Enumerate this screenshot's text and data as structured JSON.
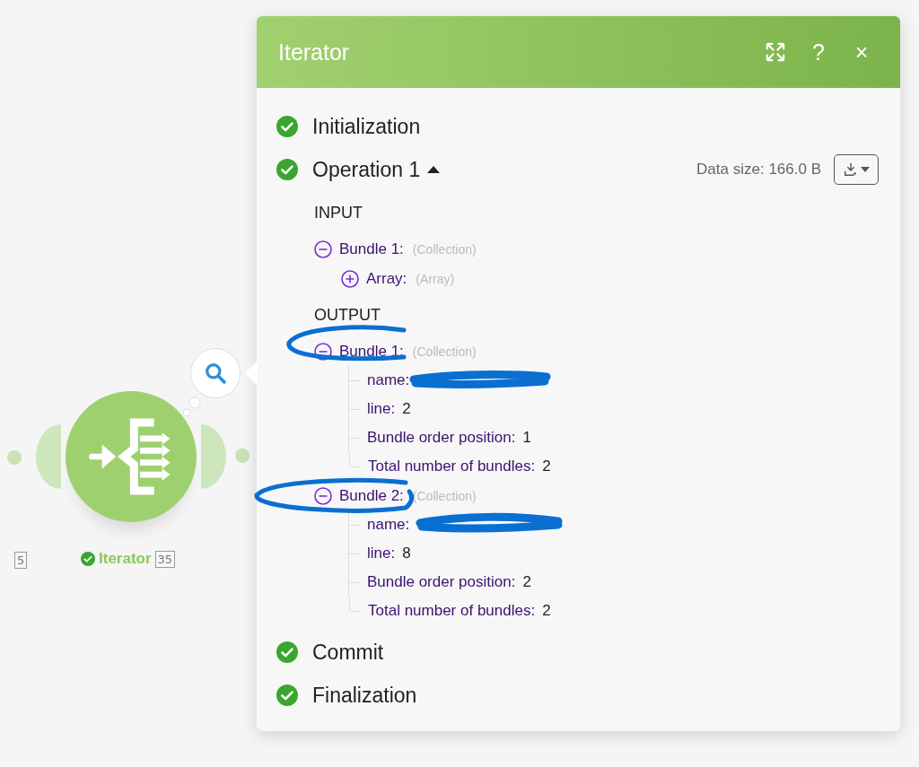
{
  "canvas": {
    "previous_badge": "5",
    "module": {
      "label": "Iterator",
      "badge": "35",
      "succeeded": true
    }
  },
  "panel": {
    "title": "Iterator",
    "help": "?",
    "close": "×",
    "data_size": "Data size: 166.0 B",
    "steps": [
      {
        "label": "Initialization",
        "succeeded": true
      },
      {
        "label": "Operation 1",
        "succeeded": true,
        "expanded": true,
        "sections": [
          {
            "heading": "INPUT",
            "items": [
              {
                "label": "Bundle 1:",
                "type": "(Collection)",
                "expanded": true,
                "children": [
                  {
                    "label": "Array:",
                    "type": "(Array)",
                    "expanded": false
                  }
                ]
              }
            ]
          },
          {
            "heading": "OUTPUT",
            "items": [
              {
                "label": "Bundle 1:",
                "type": "(Collection)",
                "expanded": true,
                "fields": [
                  {
                    "label": "name:"
                  },
                  {
                    "label": "line:",
                    "value": "2"
                  },
                  {
                    "label": "Bundle order position:",
                    "value": "1"
                  },
                  {
                    "label": "Total number of bundles:",
                    "value": "2"
                  }
                ]
              },
              {
                "label": "Bundle 2:",
                "type": "(Collection)",
                "expanded": true,
                "fields": [
                  {
                    "label": "name:"
                  },
                  {
                    "label": "line:",
                    "value": "8"
                  },
                  {
                    "label": "Bundle order position:",
                    "value": "2"
                  },
                  {
                    "label": "Total number of bundles:",
                    "value": "2"
                  }
                ]
              }
            ]
          }
        ]
      },
      {
        "label": "Commit",
        "succeeded": true
      },
      {
        "label": "Finalization",
        "succeeded": true
      }
    ]
  }
}
